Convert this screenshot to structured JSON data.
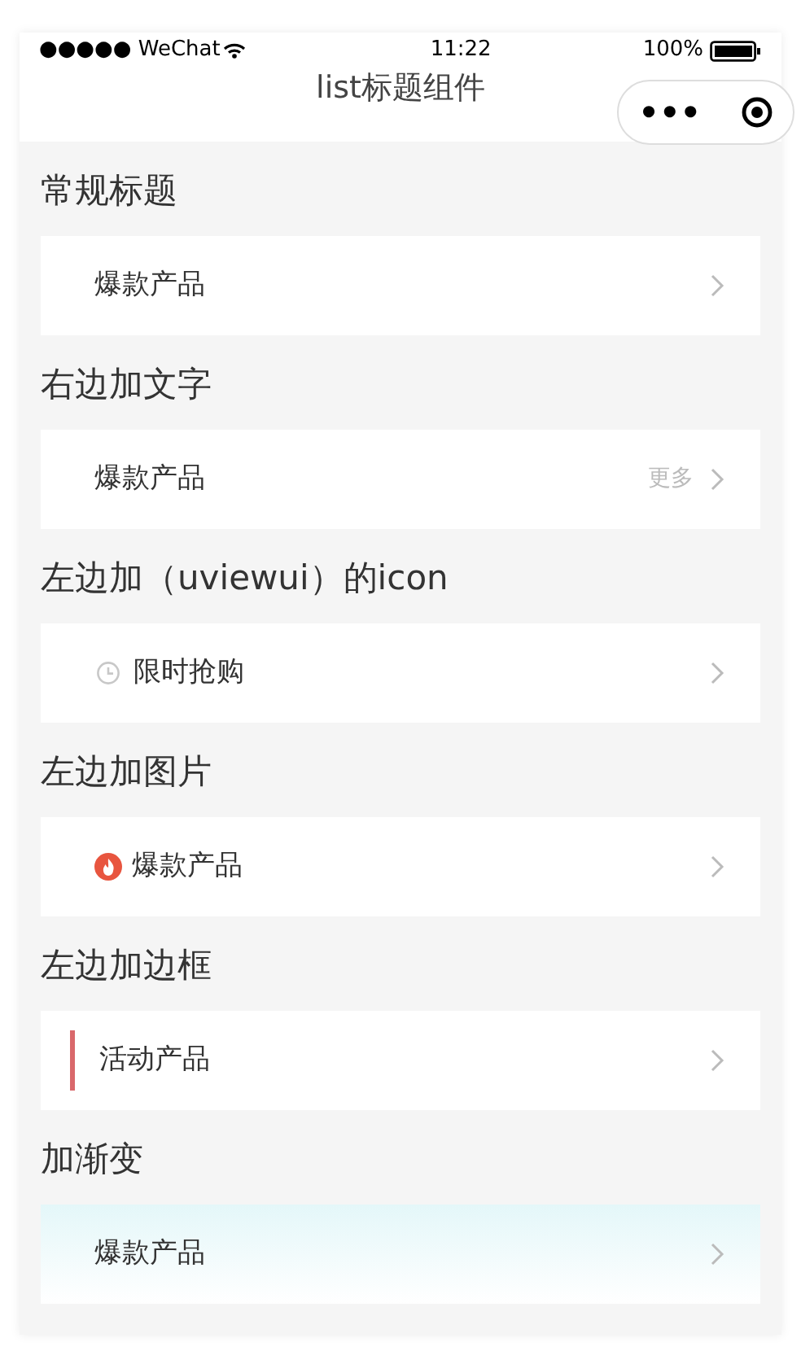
{
  "status_bar": {
    "carrier": "●●●●● WeChat",
    "time": "11:22",
    "battery": "100%"
  },
  "nav": {
    "title": "list标题组件",
    "menu": "•••"
  },
  "sections": [
    {
      "heading": "常规标题",
      "kind": "plain",
      "label": "爆款产品"
    },
    {
      "heading": "右边加文字",
      "kind": "more",
      "label": "爆款产品",
      "extra": "更多"
    },
    {
      "heading": "左边加（uviewui）的icon",
      "kind": "icon",
      "label": "限时抢购"
    },
    {
      "heading": "左边加图片",
      "kind": "image",
      "label": "爆款产品"
    },
    {
      "heading": "左边加边框",
      "kind": "border",
      "label": "活动产品",
      "color": "#d9686b"
    },
    {
      "heading": "加渐变",
      "kind": "gradient",
      "label": "爆款产品"
    }
  ]
}
